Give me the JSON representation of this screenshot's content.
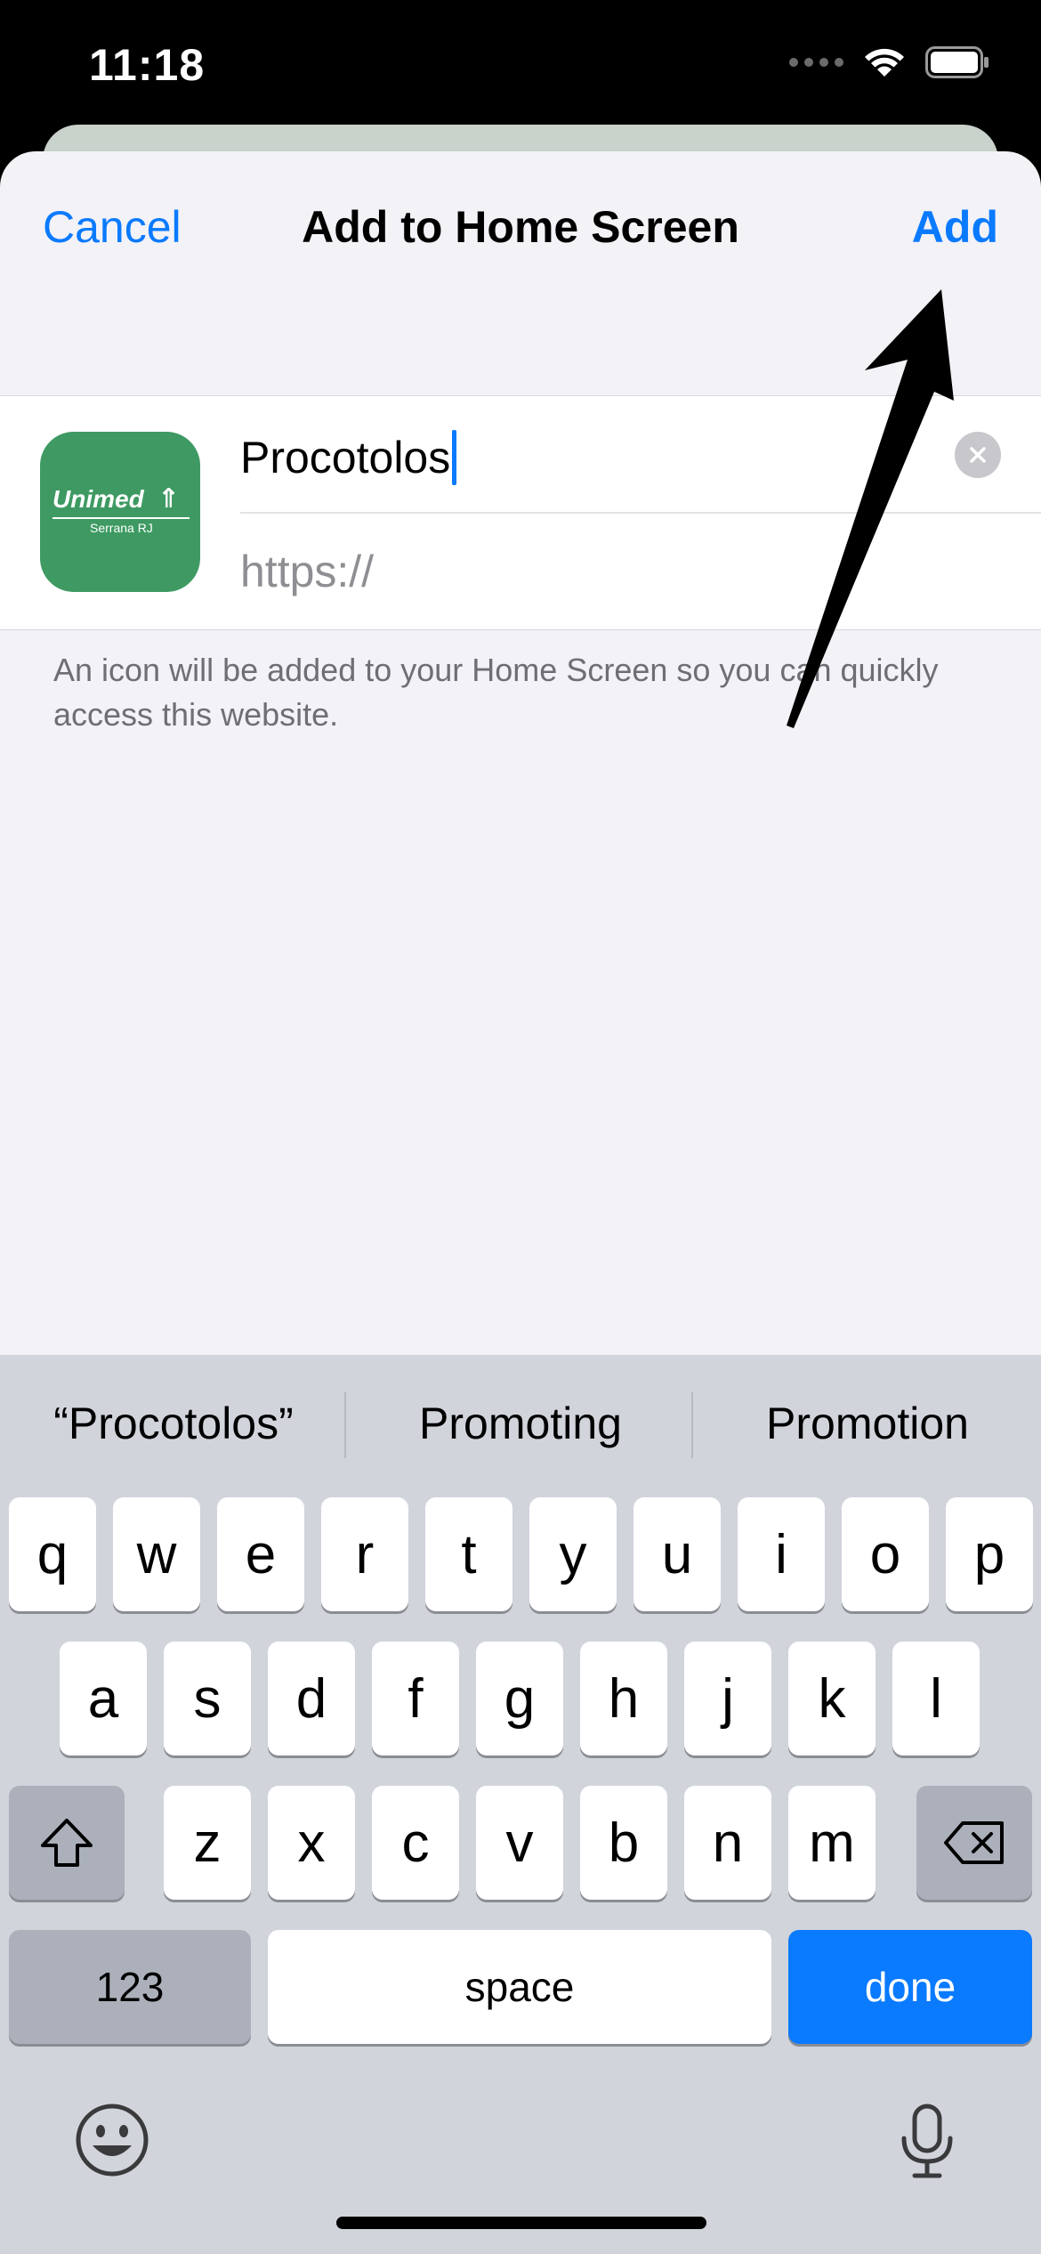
{
  "status_bar": {
    "time": "11:18"
  },
  "nav": {
    "cancel": "Cancel",
    "title": "Add to Home Screen",
    "add": "Add"
  },
  "form": {
    "name_value": "Procotolos",
    "url_value": "https://",
    "icon_brand": "Unimed",
    "icon_sub": "Serrana RJ"
  },
  "hint": "An icon will be added to your Home Screen so you can quickly access this website.",
  "suggestions": [
    "“Procotolos”",
    "Promoting",
    "Promotion"
  ],
  "keyboard": {
    "row1": [
      "q",
      "w",
      "e",
      "r",
      "t",
      "y",
      "u",
      "i",
      "o",
      "p"
    ],
    "row2": [
      "a",
      "s",
      "d",
      "f",
      "g",
      "h",
      "j",
      "k",
      "l"
    ],
    "row3": [
      "z",
      "x",
      "c",
      "v",
      "b",
      "n",
      "m"
    ],
    "numbers_label": "123",
    "space_label": "space",
    "done_label": "done"
  },
  "colors": {
    "accent": "#0a7aff",
    "icon_bg": "#3e9a62"
  }
}
